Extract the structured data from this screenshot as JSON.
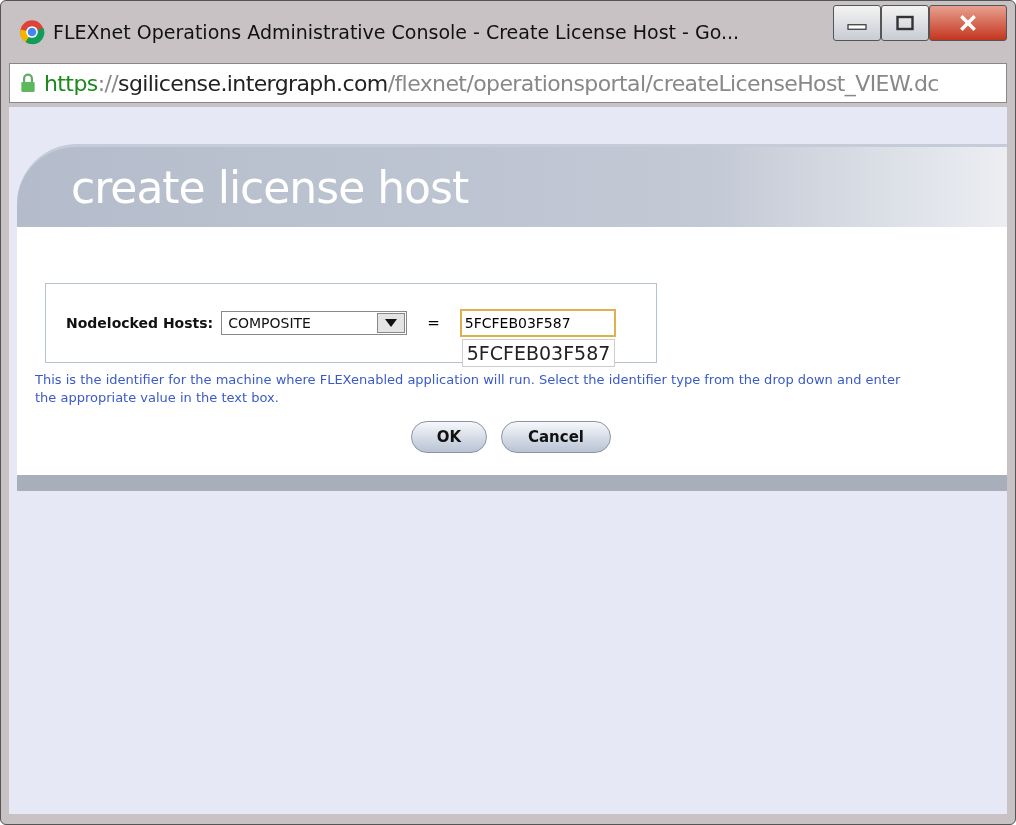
{
  "window": {
    "title": "FLEXnet Operations Administrative Console - Create License Host - Go..."
  },
  "address_bar": {
    "parts": [
      {
        "text": "https",
        "kind": "scheme"
      },
      {
        "text": "://",
        "kind": "dim"
      },
      {
        "text": "sgilicense.intergraph.com",
        "kind": "host"
      },
      {
        "text": "/flexnet/operationsportal/createLicenseHost_VIEW.dc",
        "kind": "dim"
      }
    ]
  },
  "page": {
    "heading": "create license host",
    "form": {
      "label": "Nodelocked Hosts:",
      "select_value": "COMPOSITE",
      "equals": "=",
      "input_value": "5FCFEB03F587",
      "suggestion": "5FCFEB03F587"
    },
    "help": "This is the identifier for the machine where FLEXenabled application will run. Select the identifier type from the drop down and enter the appropriate value in the text box.",
    "buttons": [
      "OK",
      "Cancel"
    ]
  }
}
